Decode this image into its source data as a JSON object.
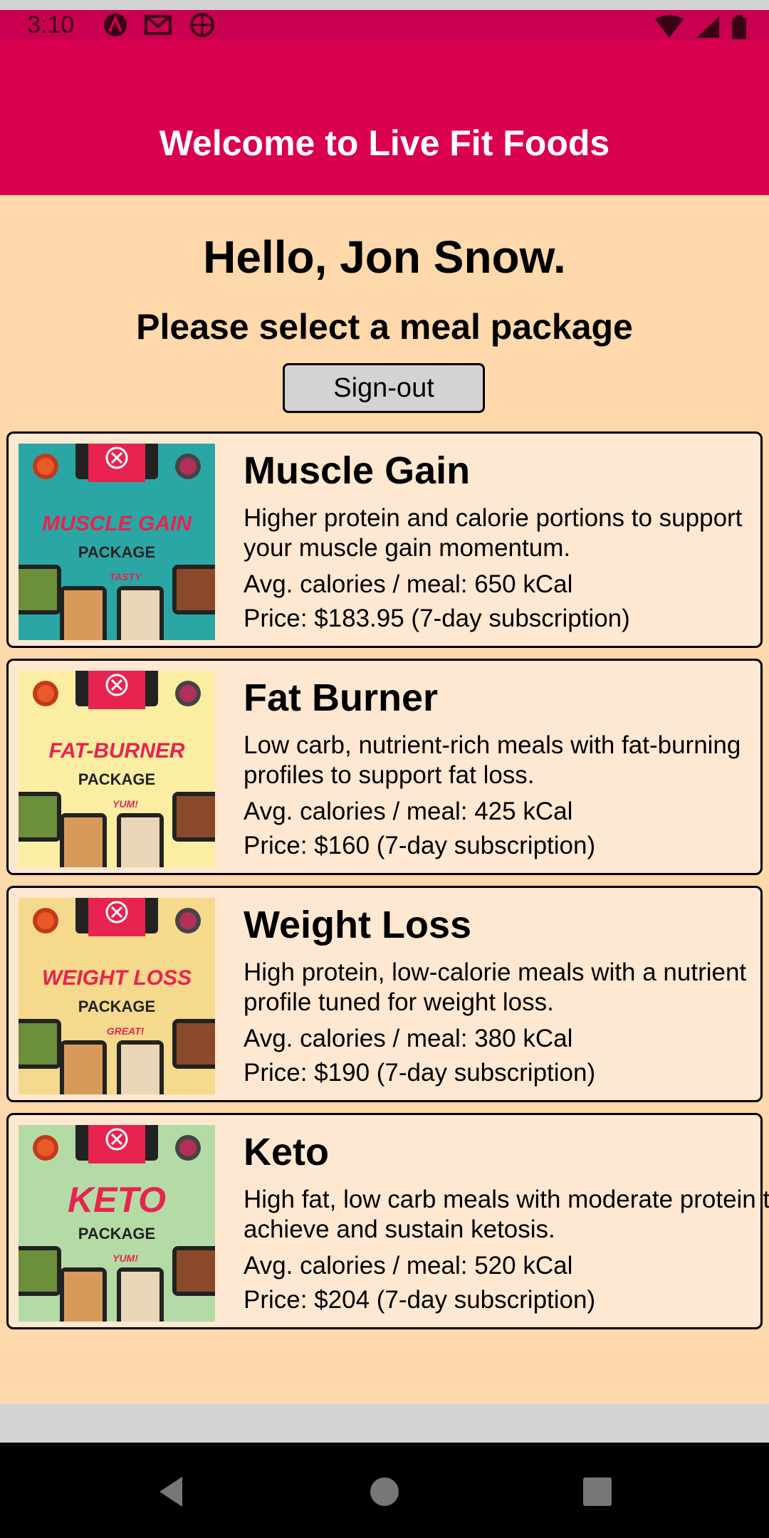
{
  "status": {
    "time": "3:10"
  },
  "app": {
    "title": "Welcome to Live Fit Foods"
  },
  "main": {
    "greeting": "Hello, Jon Snow.",
    "subtitle": "Please select a meal package",
    "signout_label": "Sign-out"
  },
  "packages": [
    {
      "title": "Muscle Gain",
      "description": "Higher protein and calorie portions to support your muscle gain momentum.",
      "calories": "Avg. calories / meal: 650 kCal",
      "price": "Price: $183.95 (7-day subscription)",
      "image_title": "MUSCLE GAIN",
      "image_sub": "PACKAGE",
      "image_tag": "TASTY",
      "bg": "#2aa7a5"
    },
    {
      "title": "Fat Burner",
      "description": "Low carb, nutrient-rich meals with fat-burning profiles to support fat loss.",
      "calories": "Avg. calories / meal: 425 kCal",
      "price": "Price: $160 (7-day subscription)",
      "image_title": "FAT-BURNER",
      "image_sub": "PACKAGE",
      "image_tag": "YUM!",
      "bg": "#fbeea2"
    },
    {
      "title": "Weight Loss",
      "description": "High protein, low-calorie meals with a nutrient profile tuned for weight loss.",
      "calories": "Avg. calories / meal: 380 kCal",
      "price": "Price: $190 (7-day subscription)",
      "image_title": "WEIGHT LOSS",
      "image_sub": "PACKAGE",
      "image_tag": "GREAT!",
      "bg": "#f5d98c"
    },
    {
      "title": "Keto",
      "description": "High fat, low carb meals with moderate protein to achieve and sustain ketosis.",
      "calories": "Avg. calories / meal: 520 kCal",
      "price": "Price: $204 (7-day subscription)",
      "image_title": "KETO",
      "image_sub": "PACKAGE",
      "image_tag": "YUM!",
      "bg": "#b4dba6"
    }
  ],
  "colors": {
    "status_bar": "#c8004f",
    "app_bar": "#d9004f",
    "content_bg": "#ffd8ac",
    "card_bg": "#ffe8d1",
    "brand_red": "#e8234f"
  }
}
